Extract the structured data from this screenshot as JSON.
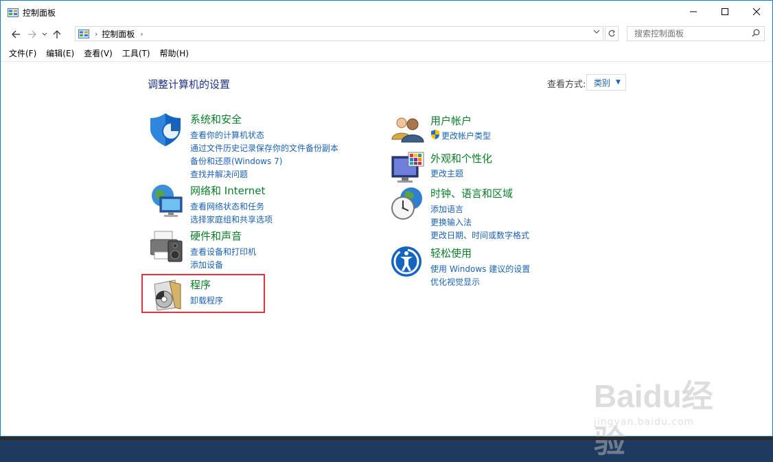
{
  "window": {
    "title": "控制面板"
  },
  "nav": {
    "breadcrumb": "控制面板",
    "search_placeholder": "搜索控制面板"
  },
  "menu": [
    "文件(F)",
    "编辑(E)",
    "查看(V)",
    "工具(T)",
    "帮助(H)"
  ],
  "page": {
    "title": "调整计算机的设置",
    "view_by_label": "查看方式:",
    "view_by_value": "类别"
  },
  "categories": [
    {
      "heading": "系统和安全",
      "links": [
        "查看你的计算机状态",
        "通过文件历史记录保存你的文件备份副本",
        "备份和还原(Windows 7)",
        "查找并解决问题"
      ],
      "icon": "shield-icon"
    },
    {
      "heading": "网络和 Internet",
      "links": [
        "查看网络状态和任务",
        "选择家庭组和共享选项"
      ],
      "icon": "network-globe-icon"
    },
    {
      "heading": "硬件和声音",
      "links": [
        "查看设备和打印机",
        "添加设备"
      ],
      "icon": "printer-speaker-icon"
    },
    {
      "heading": "程序",
      "links": [
        "卸载程序"
      ],
      "icon": "programs-disc-icon"
    },
    {
      "heading": "用户帐户",
      "links": [
        "更改帐户类型"
      ],
      "icon": "users-icon"
    },
    {
      "heading": "外观和个性化",
      "links": [
        "更改主题"
      ],
      "icon": "monitor-palette-icon"
    },
    {
      "heading": "时钟、语言和区域",
      "links": [
        "添加语言",
        "更换输入法",
        "更改日期、时间或数字格式"
      ],
      "icon": "clock-globe-icon"
    },
    {
      "heading": "轻松使用",
      "links": [
        "使用 Windows 建议的设置",
        "优化视觉显示"
      ],
      "icon": "ease-of-access-icon"
    }
  ],
  "watermark": {
    "brand": "Baidu经验",
    "url": "jingyan.baidu.com"
  },
  "colors": {
    "heading_green": "#0a7d29",
    "link_blue": "#1b62b5",
    "title_blue": "#1e3287",
    "highlight_red": "#e5313a"
  }
}
